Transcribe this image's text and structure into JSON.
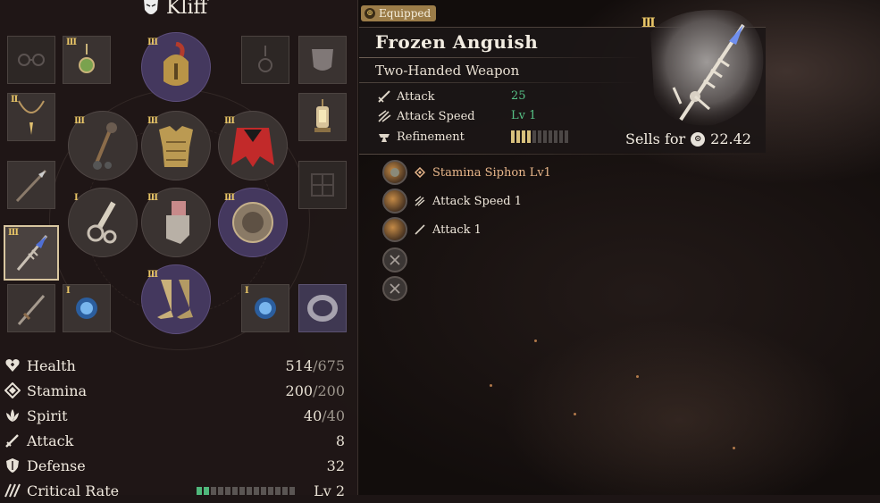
{
  "character": {
    "name": "Kliff",
    "icon": "mask-icon"
  },
  "equip_slots": [
    {
      "slot": "eyewear",
      "tier": "",
      "state": "empty",
      "icon": "glasses-icon"
    },
    {
      "slot": "earring-left",
      "tier": "III",
      "state": "filled",
      "icon": "earring-icon"
    },
    {
      "slot": "helmet",
      "tier": "III",
      "state": "filled",
      "icon": "helmet-icon"
    },
    {
      "slot": "earring-right",
      "tier": "",
      "state": "empty",
      "icon": "earring-icon"
    },
    {
      "slot": "mask",
      "tier": "",
      "state": "filled",
      "icon": "mask-slot-icon"
    },
    {
      "slot": "necklace",
      "tier": "II",
      "state": "filled",
      "icon": "necklace-icon"
    },
    {
      "slot": "lantern",
      "tier": "",
      "state": "filled",
      "icon": "lantern-icon"
    },
    {
      "slot": "main-weapon",
      "tier": "III",
      "state": "filled",
      "icon": "mace-icon"
    },
    {
      "slot": "armor",
      "tier": "III",
      "state": "filled",
      "icon": "armor-icon"
    },
    {
      "slot": "cloak",
      "tier": "III",
      "state": "filled",
      "icon": "cloak-icon"
    },
    {
      "slot": "spear",
      "tier": "",
      "state": "filled",
      "icon": "spear-icon"
    },
    {
      "slot": "backpack",
      "tier": "",
      "state": "empty",
      "icon": "backpack-icon"
    },
    {
      "slot": "two-handed",
      "tier": "III",
      "state": "selected",
      "icon": "glaive-icon"
    },
    {
      "slot": "off-weapon",
      "tier": "I",
      "state": "filled",
      "icon": "bow-icon"
    },
    {
      "slot": "gloves",
      "tier": "III",
      "state": "filled",
      "icon": "gauntlet-icon"
    },
    {
      "slot": "shield",
      "tier": "III",
      "state": "filled",
      "icon": "shield-icon"
    },
    {
      "slot": "dagger",
      "tier": "",
      "state": "filled",
      "icon": "dagger-icon"
    },
    {
      "slot": "ring-left",
      "tier": "I",
      "state": "filled",
      "icon": "ring-icon"
    },
    {
      "slot": "boots",
      "tier": "III",
      "state": "filled",
      "icon": "boots-icon"
    },
    {
      "slot": "ring-right",
      "tier": "I",
      "state": "filled",
      "icon": "ring-icon"
    },
    {
      "slot": "bracelet",
      "tier": "",
      "state": "filled",
      "icon": "bracelet-icon"
    }
  ],
  "stats": [
    {
      "label": "Health",
      "value": "514",
      "max": "/675",
      "icon": "health-icon"
    },
    {
      "label": "Stamina",
      "value": "200",
      "max": "/200",
      "icon": "stamina-icon"
    },
    {
      "label": "Spirit",
      "value": "40",
      "max": "/40",
      "icon": "spirit-icon"
    },
    {
      "label": "Attack",
      "value": "8",
      "max": "",
      "icon": "sword-icon"
    },
    {
      "label": "Defense",
      "value": "32",
      "max": "",
      "icon": "shield-stat-icon"
    },
    {
      "label": "Critical Rate",
      "value": "Lv 2",
      "max": "",
      "icon": "crit-icon",
      "pips_total": 14,
      "pips_filled": 2
    }
  ],
  "item": {
    "badge": "Equipped",
    "name": "Frozen Anguish",
    "type": "Two-Handed Weapon",
    "tier": "III",
    "properties": [
      {
        "label": "Attack",
        "value": "25",
        "icon": "sword-icon"
      },
      {
        "label": "Attack Speed",
        "value": "Lv 1",
        "icon": "attack-speed-icon"
      },
      {
        "label": "Refinement",
        "value": "",
        "icon": "anvil-icon",
        "pips_total": 11,
        "pips_filled": 4
      }
    ],
    "sells_label": "Sells for",
    "sells_value": "22.42",
    "abilities": [
      {
        "label": "Stamina Siphon Lv1",
        "state": "filled",
        "icon": "stamina-siphon-icon",
        "highlight": true
      },
      {
        "label": "Attack Speed 1",
        "state": "filled",
        "icon": "attack-speed-icon",
        "highlight": false
      },
      {
        "label": "Attack 1",
        "state": "filled",
        "icon": "sword-icon",
        "highlight": false
      },
      {
        "label": "",
        "state": "empty",
        "icon": "empty-socket-icon",
        "highlight": false
      },
      {
        "label": "",
        "state": "empty",
        "icon": "empty-socket-icon",
        "highlight": false
      }
    ]
  },
  "colors": {
    "accent_gold": "#e7c466",
    "value_green": "#56c186",
    "purple_slot": "#44385e",
    "badge": "#9c7d49"
  }
}
